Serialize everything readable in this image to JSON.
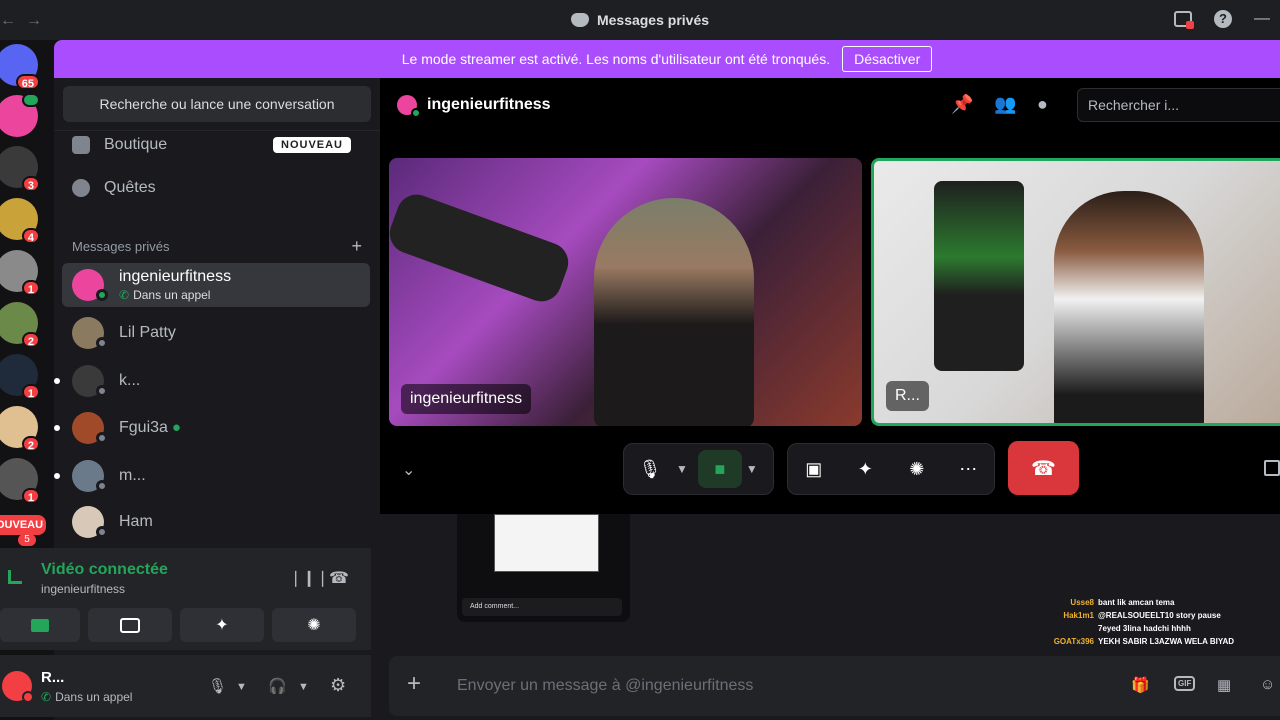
{
  "titlebar": {
    "title": "Messages privés",
    "back_glyph": "←",
    "forward_glyph": "→",
    "help_glyph": "?",
    "minimize_glyph": "—"
  },
  "banner": {
    "text": "Le mode streamer est activé. Les noms d'utilisateur ont été tronqués.",
    "button": "Désactiver"
  },
  "rail": {
    "servers": [
      {
        "badge": "65",
        "color": "#5865f2"
      },
      {
        "badge": "",
        "color": "#eb459e"
      },
      {
        "badge": "3",
        "color": "#3a3a3a"
      },
      {
        "badge": "4",
        "color": "#c9a23a"
      },
      {
        "badge": "1",
        "color": "#8a8a8a"
      },
      {
        "badge": "2",
        "color": "#6b8a4a"
      },
      {
        "badge": "1",
        "color": "#1f2a3a"
      },
      {
        "badge": "2",
        "color": "#e0c090"
      },
      {
        "badge": "1",
        "color": "#555555"
      }
    ],
    "new_label": "OUVEAU",
    "new_badge": "5"
  },
  "sidebar": {
    "search_placeholder": "Recherche ou lance une conversation",
    "shop": "Boutique",
    "new_tag": "NOUVEAU",
    "quests": "Quêtes",
    "dm_header": "Messages privés",
    "add_glyph": "+",
    "dms": [
      {
        "name": "ingenieurfitness",
        "sub": "Dans un appel",
        "color": "#eb459e"
      },
      {
        "name": "Lil Patty",
        "sub": "",
        "color": "#8a7a60"
      },
      {
        "name": "k...",
        "sub": "",
        "color": "#3a3a3a"
      },
      {
        "name": "Fgui3a",
        "sub": "",
        "color": "#a04a2a"
      },
      {
        "name": "m...",
        "sub": "",
        "color": "#6a7a8a"
      },
      {
        "name": "Ham",
        "sub": "",
        "color": "#d8c8b8"
      }
    ]
  },
  "voice": {
    "title": "Vidéo connectée",
    "channel": "ingenieurfitness"
  },
  "user": {
    "name": "R...",
    "status": "Dans un appel",
    "phone_glyph": "✆"
  },
  "main": {
    "name": "ingenieurfitness",
    "search_placeholder": "Rechercher i...",
    "tiles": [
      {
        "label": "ingenieurfitness"
      },
      {
        "label": "R..."
      }
    ]
  },
  "chat": {
    "add_comment": "Add comment...",
    "live": [
      {
        "user": "Usse8",
        "msg": "bant lik amcan tema",
        "color": "#f0b232"
      },
      {
        "user": "Hak1m1",
        "msg": "@REALSOUEELT10 story pause",
        "color": "#f0b232"
      },
      {
        "user": "",
        "msg": "7eyed 3lina hadchi hhhh",
        "color": "#f0b232"
      },
      {
        "user": "GOATx396",
        "msg": "YEKH SABIR L3AZWA WELA BIYAD",
        "color": "#f0b232"
      }
    ],
    "composer_placeholder": "Envoyer un message à @ingenieurfitness",
    "gif_label": "GIF"
  }
}
